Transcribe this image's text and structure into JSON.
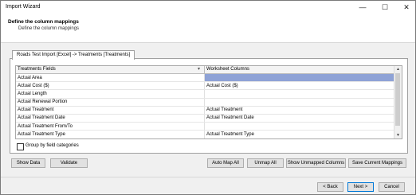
{
  "window": {
    "title": "Import Wizard"
  },
  "header": {
    "title": "Define the column mappings",
    "subtitle": "Define the column mappings"
  },
  "tab": {
    "label": "Roads Test Import [Excel] -> Treatments [Treatments]"
  },
  "grid": {
    "columns": [
      "Treatments Fields",
      "Worksheet Columns"
    ],
    "rows": [
      {
        "field": "Actual Area",
        "worksheet": ""
      },
      {
        "field": "Actual Cost ($)",
        "worksheet": "Actual Cost ($)"
      },
      {
        "field": "Actual Length",
        "worksheet": ""
      },
      {
        "field": "Actual Renewal Portion",
        "worksheet": ""
      },
      {
        "field": "Actual Treatment",
        "worksheet": "Actual Treatment"
      },
      {
        "field": "Actual Treatment Date",
        "worksheet": "Actual Treatment Date"
      },
      {
        "field": "Actual Treatment From/To",
        "worksheet": ""
      },
      {
        "field": "Actual Treatment Type",
        "worksheet": "Actual Treatment Type"
      }
    ]
  },
  "group_by": {
    "label": "Group by field categories",
    "checked": false
  },
  "buttons": {
    "show_data": "Show Data",
    "validate": "Validate",
    "auto_map_all": "Auto Map All",
    "unmap_all": "Unmap All",
    "show_unmapped": "Show Unmapped Columns",
    "save_mappings": "Save Current Mappings",
    "back": "< Back",
    "next": "Next >",
    "cancel": "Cancel"
  },
  "icons": {
    "minimize": "minimize-icon",
    "maximize": "maximize-icon",
    "close": "close-icon",
    "sort": "sort-icon"
  },
  "colors": {
    "selection": "#8ea2d6",
    "focus_border": "#0078d7"
  }
}
